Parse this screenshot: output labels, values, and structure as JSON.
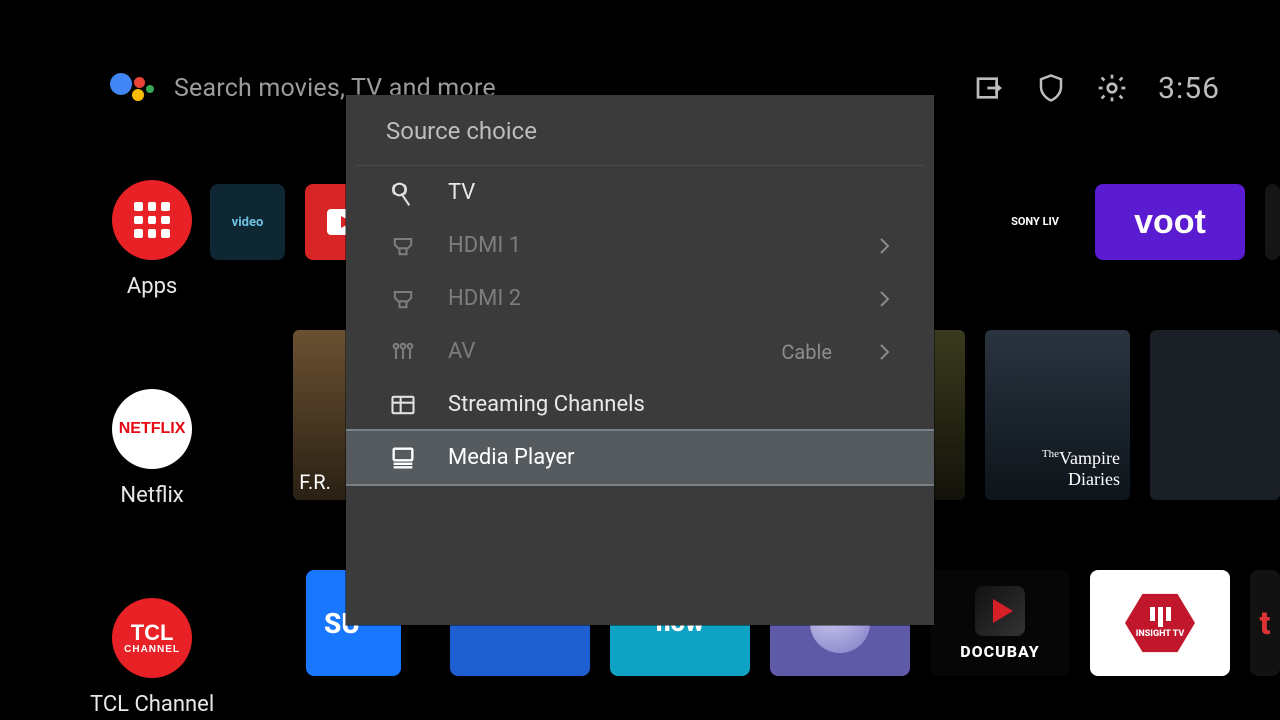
{
  "header": {
    "search_placeholder": "Search movies, TV and more",
    "clock": "3:56"
  },
  "rail": {
    "apps": {
      "label": "Apps"
    },
    "netflix": {
      "label": "Netflix",
      "logo_text": "NETFLIX"
    },
    "tcl": {
      "label": "TCL Channel",
      "logo_line1": "TCL",
      "logo_line2": "CHANNEL"
    }
  },
  "row1": {
    "prime": "video",
    "sony": "SONY LIV",
    "voot": "voot"
  },
  "row2": {
    "friends": "F.R.",
    "vampire_l1": "Vampire",
    "vampire_l2": "Diaries"
  },
  "row3": {
    "su": "SU",
    "now": "now",
    "docubay": "DOCUBAY",
    "insight": "INSIGHT TV",
    "t": "t"
  },
  "dialog": {
    "title": "Source choice",
    "options": [
      {
        "id": "tv",
        "label": "TV",
        "enabled": true,
        "selected": false,
        "chevron": false,
        "meta": "",
        "icon": "antenna"
      },
      {
        "id": "hdmi1",
        "label": "HDMI 1",
        "enabled": false,
        "selected": false,
        "chevron": true,
        "meta": "",
        "icon": "hdmi"
      },
      {
        "id": "hdmi2",
        "label": "HDMI 2",
        "enabled": false,
        "selected": false,
        "chevron": true,
        "meta": "",
        "icon": "hdmi"
      },
      {
        "id": "av",
        "label": "AV",
        "enabled": false,
        "selected": false,
        "chevron": true,
        "meta": "Cable",
        "icon": "av"
      },
      {
        "id": "streaming",
        "label": "Streaming Channels",
        "enabled": true,
        "selected": false,
        "chevron": false,
        "meta": "",
        "icon": "grid"
      },
      {
        "id": "media",
        "label": "Media Player",
        "enabled": true,
        "selected": true,
        "chevron": false,
        "meta": "",
        "icon": "media"
      }
    ]
  }
}
